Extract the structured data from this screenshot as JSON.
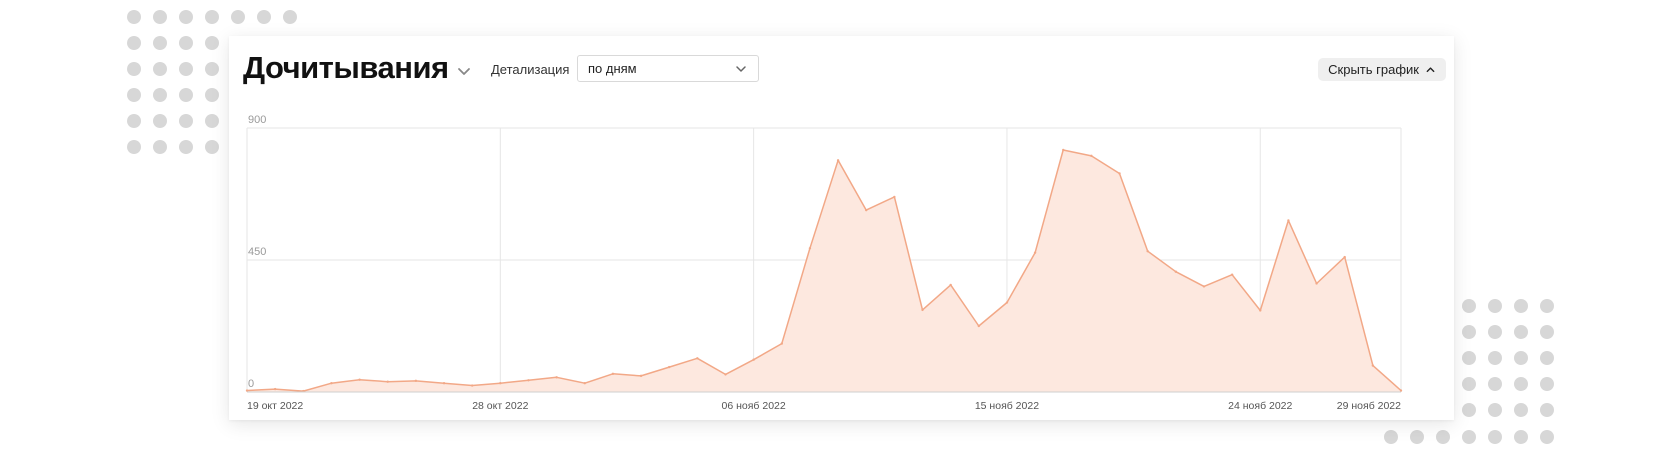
{
  "header": {
    "title": "Дочитывания",
    "title_chevron_icon": "chevron-down-icon",
    "detail_label": "Детализация",
    "detail_select_value": "по дням",
    "detail_select_icon": "chevron-down-icon",
    "hide_button_label": "Скрыть график",
    "hide_button_icon": "chevron-up-icon"
  },
  "colors": {
    "series_line": "#f2a887",
    "series_fill": "#fde8df",
    "grid": "#e6e6e6",
    "decor_dots": "#d7d7d7"
  },
  "chart_data": {
    "type": "area",
    "title": "",
    "xlabel": "",
    "ylabel": "",
    "ylim": [
      0,
      900
    ],
    "y_ticks": [
      "900",
      "450",
      "0"
    ],
    "x_tick_labels": [
      "19 окт 2022",
      "28 окт 2022",
      "06 нояб 2022",
      "15 нояб 2022",
      "24 нояб 2022",
      "29 нояб 2022"
    ],
    "grid": true,
    "x": [
      "19 окт 2022",
      "20 окт 2022",
      "21 окт 2022",
      "22 окт 2022",
      "23 окт 2022",
      "24 окт 2022",
      "25 окт 2022",
      "26 окт 2022",
      "27 окт 2022",
      "28 окт 2022",
      "29 окт 2022",
      "30 окт 2022",
      "31 окт 2022",
      "01 нояб 2022",
      "02 нояб 2022",
      "03 нояб 2022",
      "04 нояб 2022",
      "05 нояб 2022",
      "06 нояб 2022",
      "07 нояб 2022",
      "08 нояб 2022",
      "09 нояб 2022",
      "10 нояб 2022",
      "11 нояб 2022",
      "12 нояб 2022",
      "13 нояб 2022",
      "14 нояб 2022",
      "15 нояб 2022",
      "16 нояб 2022",
      "17 нояб 2022",
      "18 нояб 2022",
      "19 нояб 2022",
      "20 нояб 2022",
      "21 нояб 2022",
      "22 нояб 2022",
      "23 нояб 2022",
      "24 нояб 2022",
      "25 нояб 2022",
      "26 нояб 2022",
      "27 нояб 2022",
      "28 нояб 2022",
      "29 нояб 2022"
    ],
    "series": [
      {
        "values": [
          5,
          10,
          3,
          30,
          42,
          35,
          38,
          30,
          22,
          30,
          40,
          50,
          30,
          62,
          55,
          85,
          115,
          60,
          110,
          165,
          490,
          790,
          620,
          665,
          280,
          365,
          225,
          305,
          475,
          825,
          805,
          745,
          480,
          410,
          360,
          400,
          278,
          585,
          370,
          460,
          90,
          5
        ]
      }
    ]
  }
}
